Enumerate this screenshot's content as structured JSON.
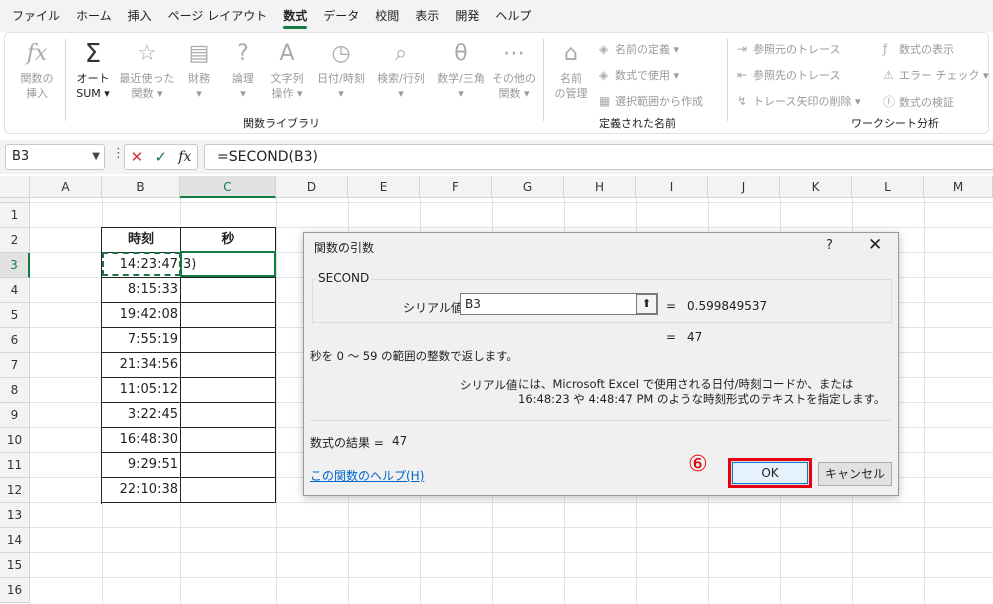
{
  "menu": [
    "ファイル",
    "ホーム",
    "挿入",
    "ページ レイアウト",
    "数式",
    "データ",
    "校閲",
    "表示",
    "開発",
    "ヘルプ"
  ],
  "ribbon": {
    "function_library": {
      "label": "関数ライブラリ",
      "buttons": [
        {
          "icon": "fx",
          "l1": "関数の",
          "l2": "挿入"
        },
        {
          "icon": "Σ",
          "l1": "オート",
          "l2": "SUM ▾"
        },
        {
          "icon": "☆",
          "l1": "最近使った",
          "l2": "関数 ▾"
        },
        {
          "icon": "▤",
          "l1": "財務",
          "l2": "▾"
        },
        {
          "icon": "?",
          "l1": "論理",
          "l2": "▾"
        },
        {
          "icon": "A",
          "l1": "文字列",
          "l2": "操作 ▾"
        },
        {
          "icon": "◷",
          "l1": "日付/時刻",
          "l2": "▾"
        },
        {
          "icon": "⌕",
          "l1": "検索/行列",
          "l2": "▾"
        },
        {
          "icon": "θ",
          "l1": "数学/三角",
          "l2": "▾"
        },
        {
          "icon": "⋯",
          "l1": "その他の",
          "l2": "関数 ▾"
        }
      ]
    },
    "defined_names": {
      "label": "定義された名前",
      "manager_l1": "名前",
      "manager_l2": "の管理",
      "define": "名前の定義  ▾",
      "use_in_formula": "数式で使用  ▾",
      "create_from_selection": "選択範囲から作成"
    },
    "formula_auditing": {
      "label": "ワークシート分析",
      "trace_precedents": "参照元のトレース",
      "trace_dependents": "参照先のトレース",
      "remove_arrows": "トレース矢印の削除  ▾",
      "show_formulas": "数式の表示",
      "error_checking": "エラー チェック  ▾",
      "evaluate": "数式の検証"
    }
  },
  "formula_bar": {
    "name_box": "B3",
    "formula": "=SECOND(B3)"
  },
  "columns": [
    "A",
    "B",
    "C",
    "D",
    "E",
    "F",
    "G",
    "H",
    "I",
    "J",
    "K",
    "L",
    "M"
  ],
  "rows": [
    "1",
    "2",
    "3",
    "4",
    "5",
    "6",
    "7",
    "8",
    "9",
    "10",
    "11",
    "12",
    "13",
    "14",
    "15",
    "16"
  ],
  "table": {
    "header_time": "時刻",
    "header_sec": "秒",
    "times": [
      "14:23:47",
      "8:15:33",
      "19:42:08",
      "7:55:19",
      "21:34:56",
      "11:05:12",
      "3:22:45",
      "16:48:30",
      "9:29:51",
      "22:10:38"
    ],
    "c3_text": "3)"
  },
  "dialog": {
    "title": "関数の引数",
    "help": "?",
    "close": "✕",
    "function_name": "SECOND",
    "arg_label": "シリアル値",
    "arg_value": "B3",
    "arg_eq": "=",
    "arg_result": "0.599849537",
    "result_eq": "=",
    "result_value": "47",
    "description": "秒を 0 〜 59 の範囲の整数で返します。",
    "arg_desc_label": "シリアル値",
    "arg_desc": "には、Microsoft Excel で使用される日付/時刻コードか、または 16:48:23 や 4:48:47 PM のような時刻形式のテキストを指定します。",
    "formula_result_label": "数式の結果 =",
    "formula_result_value": "47",
    "help_link": "この関数のヘルプ(H)",
    "step": "⑥",
    "ok": "OK",
    "cancel": "キャンセル"
  }
}
